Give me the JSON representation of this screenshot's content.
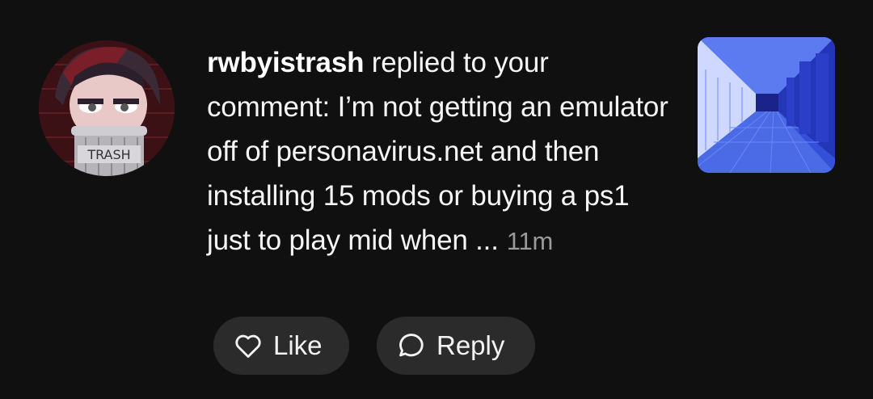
{
  "notification": {
    "username": "rwbyistrash",
    "action_text": " replied to your comment: I’m not getting an emulator off of personavirus.net and then installing 15 mods or buying a ps1 just to play mid when ...",
    "timestamp": "11m",
    "avatar_icon": "anime-character-in-trash-can-avatar",
    "avatar_label": "TRASH",
    "thumbnail_icon": "blue-hallway-thumbnail"
  },
  "actions": {
    "like_label": "Like",
    "like_icon": "heart-outline-icon",
    "reply_label": "Reply",
    "reply_icon": "speech-bubble-icon"
  },
  "colors": {
    "background": "#101010",
    "button_bg": "#2b2b2b",
    "text": "#f5f5f5",
    "timestamp": "#9a9a9a"
  }
}
